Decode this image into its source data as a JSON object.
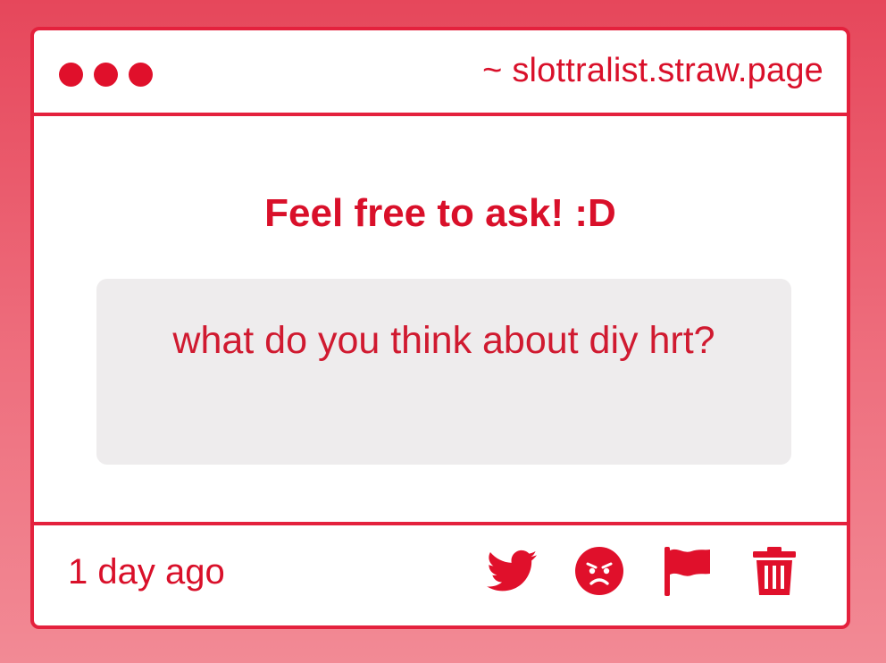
{
  "window": {
    "url": "~ slottralist.straw.page",
    "controls": [
      "close-dot",
      "minimize-dot",
      "maximize-dot"
    ]
  },
  "content": {
    "heading": "Feel free to ask! :D",
    "question": "what do you think about diy hrt?"
  },
  "footer": {
    "timestamp": "1 day ago",
    "actions": [
      {
        "icon": "twitter-icon"
      },
      {
        "icon": "angry-face-icon"
      },
      {
        "icon": "flag-icon"
      },
      {
        "icon": "trash-icon"
      }
    ]
  },
  "colors": {
    "accent": "#e0102b",
    "border": "#e4213d",
    "question_bg": "#eeeced"
  }
}
